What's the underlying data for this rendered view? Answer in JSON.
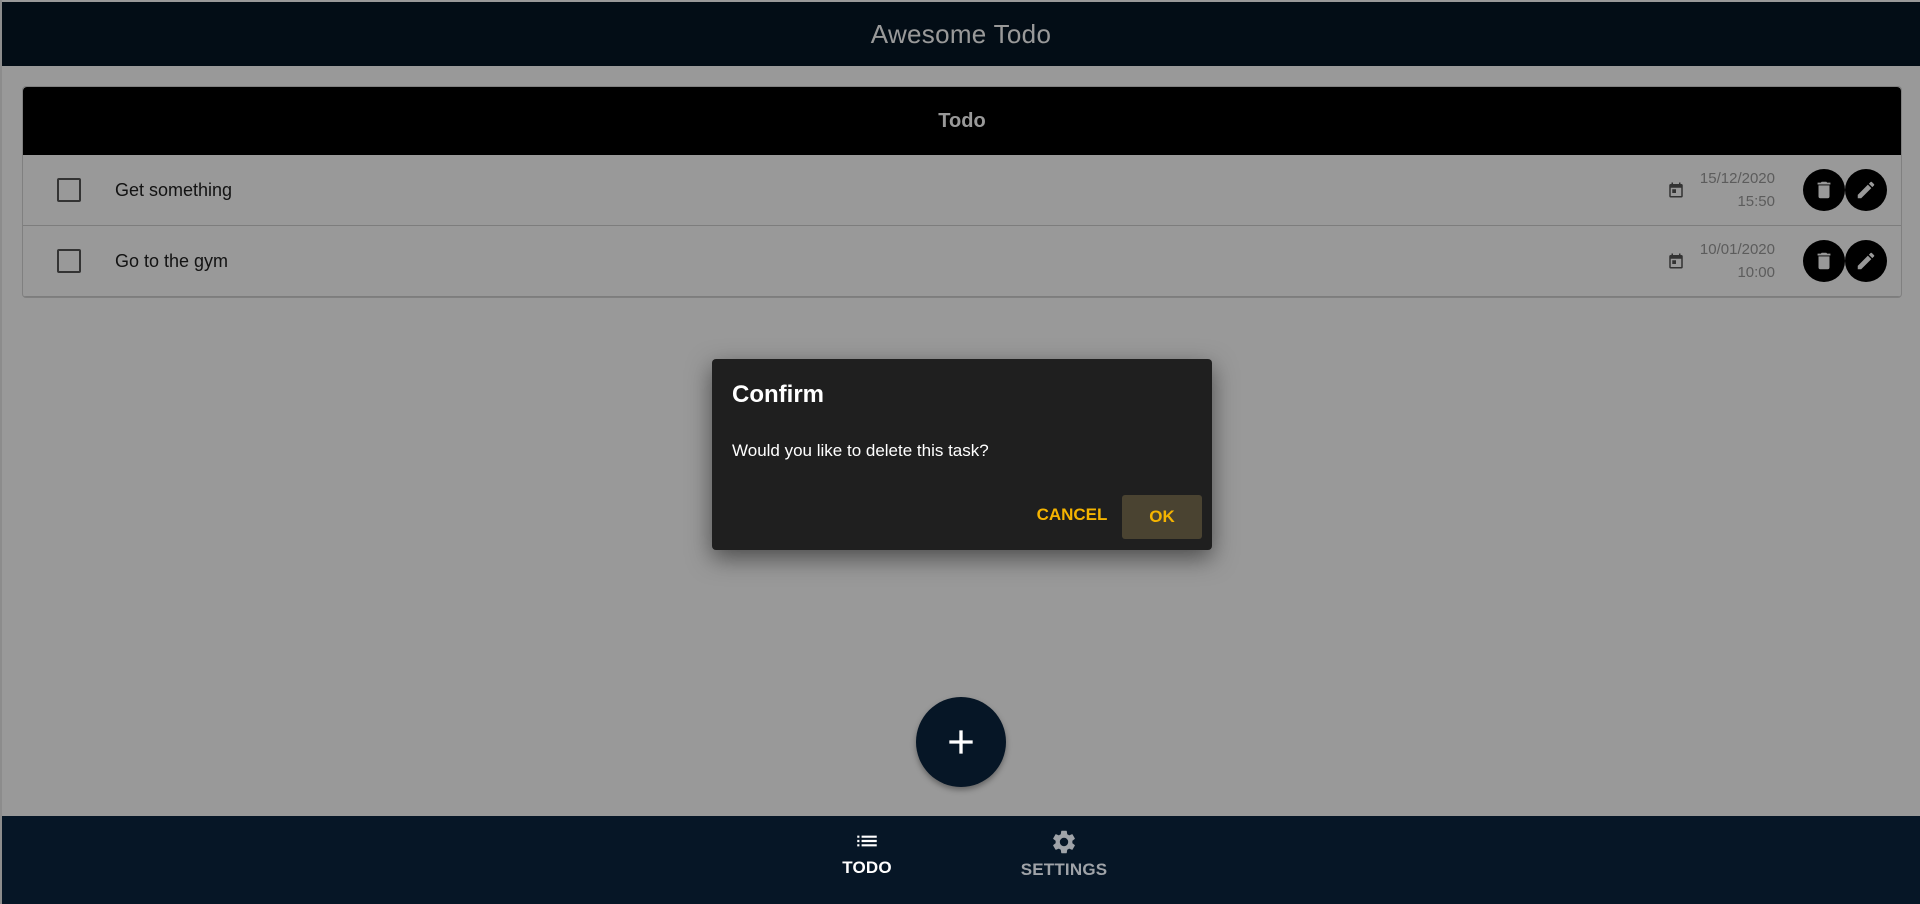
{
  "app": {
    "title": "Awesome Todo"
  },
  "todo_card": {
    "header": "Todo",
    "items": [
      {
        "text": "Get something",
        "date": "15/12/2020",
        "time": "15:50",
        "done": false
      },
      {
        "text": "Go to the gym",
        "date": "10/01/2020",
        "time": "10:00",
        "done": false
      }
    ]
  },
  "icons": {
    "calendar": "calendar-icon",
    "delete": "trash-icon",
    "edit": "pencil-icon",
    "add": "plus-icon",
    "todo_nav": "list-icon",
    "settings_nav": "gear-icon"
  },
  "bottom_nav": {
    "items": [
      {
        "label": "TODO",
        "active": true
      },
      {
        "label": "SETTINGS",
        "active": false
      }
    ]
  },
  "dialog": {
    "title": "Confirm",
    "message": "Would you like to delete this task?",
    "cancel_label": "CANCEL",
    "ok_label": "OK"
  },
  "colors": {
    "primary": "#061626",
    "accent": "#f5b400",
    "dialog_bg": "#1f1f1f",
    "header_bg": "#000000"
  }
}
